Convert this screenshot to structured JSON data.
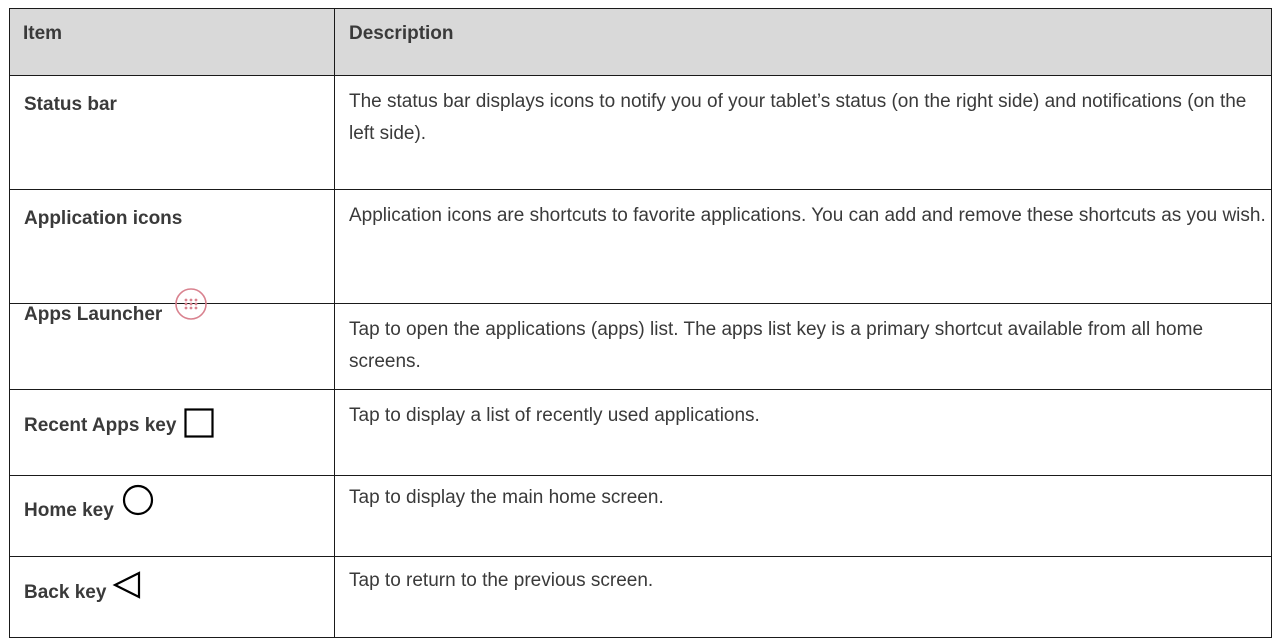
{
  "table": {
    "headers": {
      "item": "Item",
      "description": "Description"
    },
    "rows": [
      {
        "item": "Status bar",
        "description": "The status bar displays icons to notify you of your tablet’s status (on the right side) and notifications (on the left side).",
        "icon": null
      },
      {
        "item": "Application icons",
        "description": "Application icons are shortcuts to favorite applications. You can add and remove these shortcuts as you wish.",
        "icon": null
      },
      {
        "item": "Apps Launcher",
        "description": "Tap to open the applications (apps) list. The apps list key is a primary shortcut available from all home screens.",
        "icon": "apps-launcher-icon"
      },
      {
        "item": "Recent Apps key",
        "description": "Tap to display a list of recently used applications.",
        "icon": "square-icon"
      },
      {
        "item": "Home key",
        "description": "Tap to display the main home screen.",
        "icon": "circle-icon"
      },
      {
        "item": "Back key",
        "description": "Tap to return to the previous screen.",
        "icon": "triangle-left-icon"
      }
    ]
  },
  "colors": {
    "header_background": "#d9d9d9",
    "text": "#3a3a3a",
    "border": "#1a1a1a",
    "launcher_icon": "#d9828f"
  }
}
